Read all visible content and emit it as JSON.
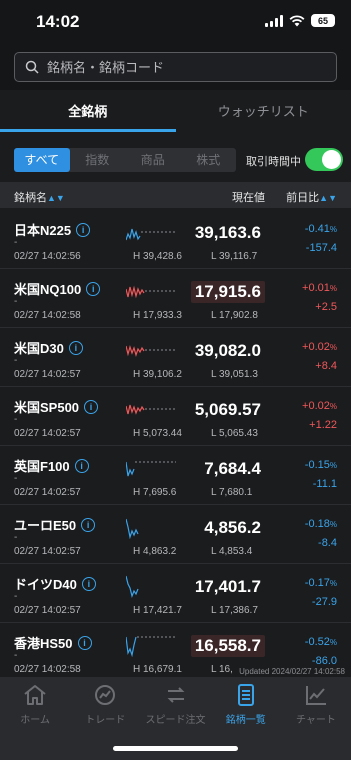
{
  "status": {
    "time": "14:02",
    "battery": "65"
  },
  "search": {
    "placeholder": "銘柄名・銘柄コード"
  },
  "tabs": [
    {
      "label": "全銘柄"
    },
    {
      "label": "ウォッチリスト"
    }
  ],
  "filters": [
    {
      "label": "すべて"
    },
    {
      "label": "指数"
    },
    {
      "label": "商品"
    },
    {
      "label": "株式"
    }
  ],
  "realtime_label": "取引時間中",
  "columns": {
    "name": "銘柄名",
    "price": "現在値",
    "change": "前日比"
  },
  "colors": {
    "accent": "#3aa4ea",
    "positive": "#f0585a",
    "negative": "#3aa4ea",
    "toggle": "#34c759"
  },
  "rows": [
    {
      "name": "日本N225",
      "dash": "-",
      "time": "02/27 14:02:56",
      "price": "39,163.6",
      "high": "H 39,428.6",
      "low": "L 39,116.7",
      "pct": "-0.41",
      "unit": "%",
      "diff": "-157.4"
    },
    {
      "name": "米国NQ100",
      "dash": "-",
      "time": "02/27 14:02:58",
      "price": "17,915.6",
      "high": "H 17,933.3",
      "low": "L 17,902.8",
      "pct": "+0.01",
      "unit": "%",
      "diff": "+2.5"
    },
    {
      "name": "米国D30",
      "dash": "-",
      "time": "02/27 14:02:57",
      "price": "39,082.0",
      "high": "H 39,106.2",
      "low": "L 39,051.3",
      "pct": "+0.02",
      "unit": "%",
      "diff": "+8.4"
    },
    {
      "name": "米国SP500",
      "dash": "-",
      "time": "02/27 14:02:57",
      "price": "5,069.57",
      "high": "H 5,073.44",
      "low": "L 5,065.43",
      "pct": "+0.02",
      "unit": "%",
      "diff": "+1.22"
    },
    {
      "name": "英国F100",
      "dash": "-",
      "time": "02/27 14:02:57",
      "price": "7,684.4",
      "high": "H 7,695.6",
      "low": "L 7,680.1",
      "pct": "-0.15",
      "unit": "%",
      "diff": "-11.1"
    },
    {
      "name": "ユーロE50",
      "dash": "-",
      "time": "02/27 14:02:57",
      "price": "4,856.2",
      "high": "H 4,863.2",
      "low": "L 4,853.4",
      "pct": "-0.18",
      "unit": "%",
      "diff": "-8.4"
    },
    {
      "name": "ドイツD40",
      "dash": "-",
      "time": "02/27 14:02:57",
      "price": "17,401.7",
      "high": "H 17,421.7",
      "low": "L 17,386.7",
      "pct": "-0.17",
      "unit": "%",
      "diff": "-27.9"
    },
    {
      "name": "香港HS50",
      "dash": "-",
      "time": "02/27 14:02:58",
      "price": "16,558.7",
      "high": "H 16,679.1",
      "low": "L 16,",
      "pct": "-0.52",
      "unit": "%",
      "diff": "-86.0"
    }
  ],
  "updated": "Updated 2024/02/27 14:02:58",
  "tabbar": [
    {
      "label": "ホーム",
      "icon": "home-icon"
    },
    {
      "label": "トレード",
      "icon": "trade-icon"
    },
    {
      "label": "スピード注文",
      "icon": "speed-order-icon"
    },
    {
      "label": "銘柄一覧",
      "icon": "list-icon"
    },
    {
      "label": "チャート",
      "icon": "chart-icon"
    }
  ]
}
